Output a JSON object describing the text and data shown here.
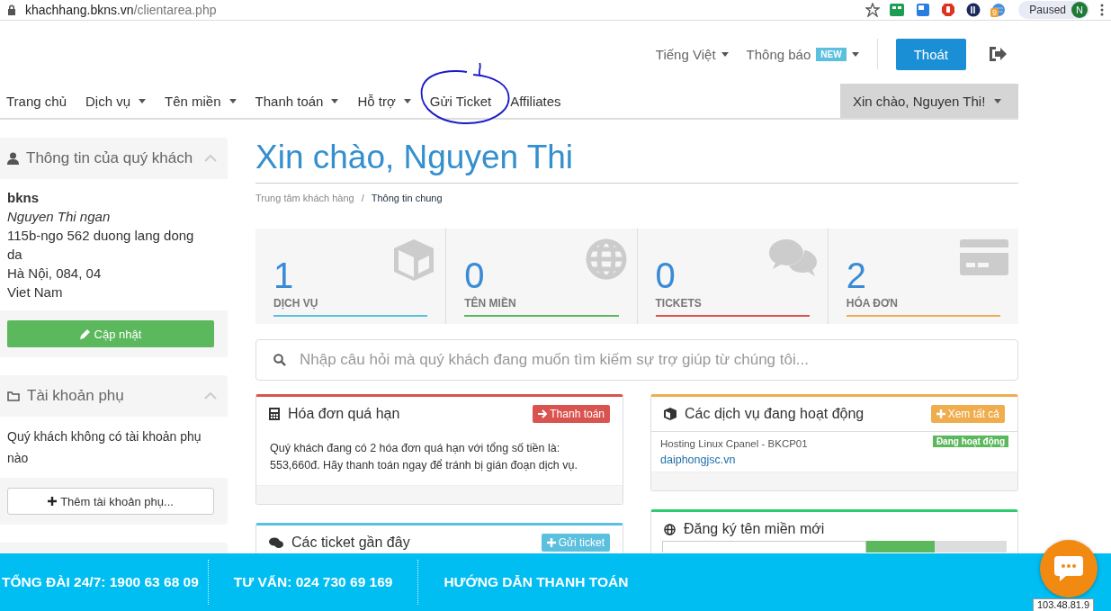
{
  "browser": {
    "url_host": "khachhang.bkns.vn",
    "url_path": "/clientarea.php",
    "extension_badge": "9",
    "profile_status": "Paused",
    "profile_initial": "N"
  },
  "topbar": {
    "language": "Tiếng Việt",
    "notifications": "Thông báo",
    "notifications_badge": "NEW",
    "logout": "Thoát"
  },
  "nav": {
    "items": [
      {
        "label": "Trang chủ",
        "dropdown": false,
        "circled": false
      },
      {
        "label": "Dịch vụ",
        "dropdown": true,
        "circled": false
      },
      {
        "label": "Tên miền",
        "dropdown": true,
        "circled": false
      },
      {
        "label": "Thanh toán",
        "dropdown": true,
        "circled": false
      },
      {
        "label": "Hỗ trợ",
        "dropdown": true,
        "circled": false
      },
      {
        "label": "Gửi Ticket",
        "dropdown": false,
        "circled": true
      },
      {
        "label": "Affiliates",
        "dropdown": false,
        "circled": false
      }
    ],
    "user_menu": "Xin chào, Nguyen Thi!"
  },
  "sidebar": {
    "client": {
      "title": "Thông tin của quý khách",
      "company": "bkns",
      "name": "Nguyen Thi ngan",
      "address": [
        "115b-ngo 562 duong lang dong da",
        "Hà Nội, 084, 04",
        "Viet Nam"
      ],
      "button": "Cập nhật"
    },
    "contacts": {
      "title": "Tài khoản phụ",
      "text": "Quý khách không có tài khoản phụ nào",
      "button": "Thêm tài khoản phụ..."
    }
  },
  "main": {
    "title": "Xin chào, Nguyen Thi",
    "breadcrumb_separator": "/",
    "breadcrumb": [
      {
        "label": "Trung tâm khách hàng",
        "current": false
      },
      {
        "label": "Thông tin chung",
        "current": true
      }
    ],
    "stats": [
      {
        "value": "1",
        "label": "DỊCH VỤ",
        "color": "#5bc0de",
        "kind": "box"
      },
      {
        "value": "0",
        "label": "TÊN MIỀN",
        "color": "#5cb85c",
        "kind": "globe"
      },
      {
        "value": "0",
        "label": "TICKETS",
        "color": "#d9534f",
        "kind": "chat"
      },
      {
        "value": "2",
        "label": "HÓA ĐƠN",
        "color": "#f0ad4e",
        "kind": "card"
      }
    ],
    "search_placeholder": "Nhập câu hỏi mà quý khách đang muốn tìm kiếm sự trợ giúp từ chúng tôi...",
    "overdue": {
      "title": "Hóa đơn quá hạn",
      "color": "#d9534f",
      "button": "Thanh toán",
      "text": "Quý khách đang có 2 hóa đơn quá hạn với tổng số tiền là: 553,660đ. Hãy thanh toán ngay để tránh bị gián đoạn dịch vụ."
    },
    "tickets": {
      "title": "Các ticket gần đây",
      "color": "#5bc0de",
      "button": "Gửi ticket"
    },
    "services": {
      "title": "Các dịch vụ đang hoạt động",
      "color": "#f0ad4e",
      "button": "Xem tất cả",
      "items": [
        {
          "product": "Hosting Linux Cpanel - BKCP01",
          "domain": "daiphongjsc.vn",
          "status": "Đang hoạt động"
        }
      ]
    },
    "domain": {
      "title": "Đăng ký tên miền mới",
      "color": "#2ecc71"
    }
  },
  "footer": {
    "items": [
      "TỔNG ĐÀI 24/7: 1900 63 68 09",
      "TƯ VẤN: 024 730 69 169",
      "HƯỚNG DẪN THANH TOÁN"
    ],
    "ip": "103.48.81.9"
  }
}
